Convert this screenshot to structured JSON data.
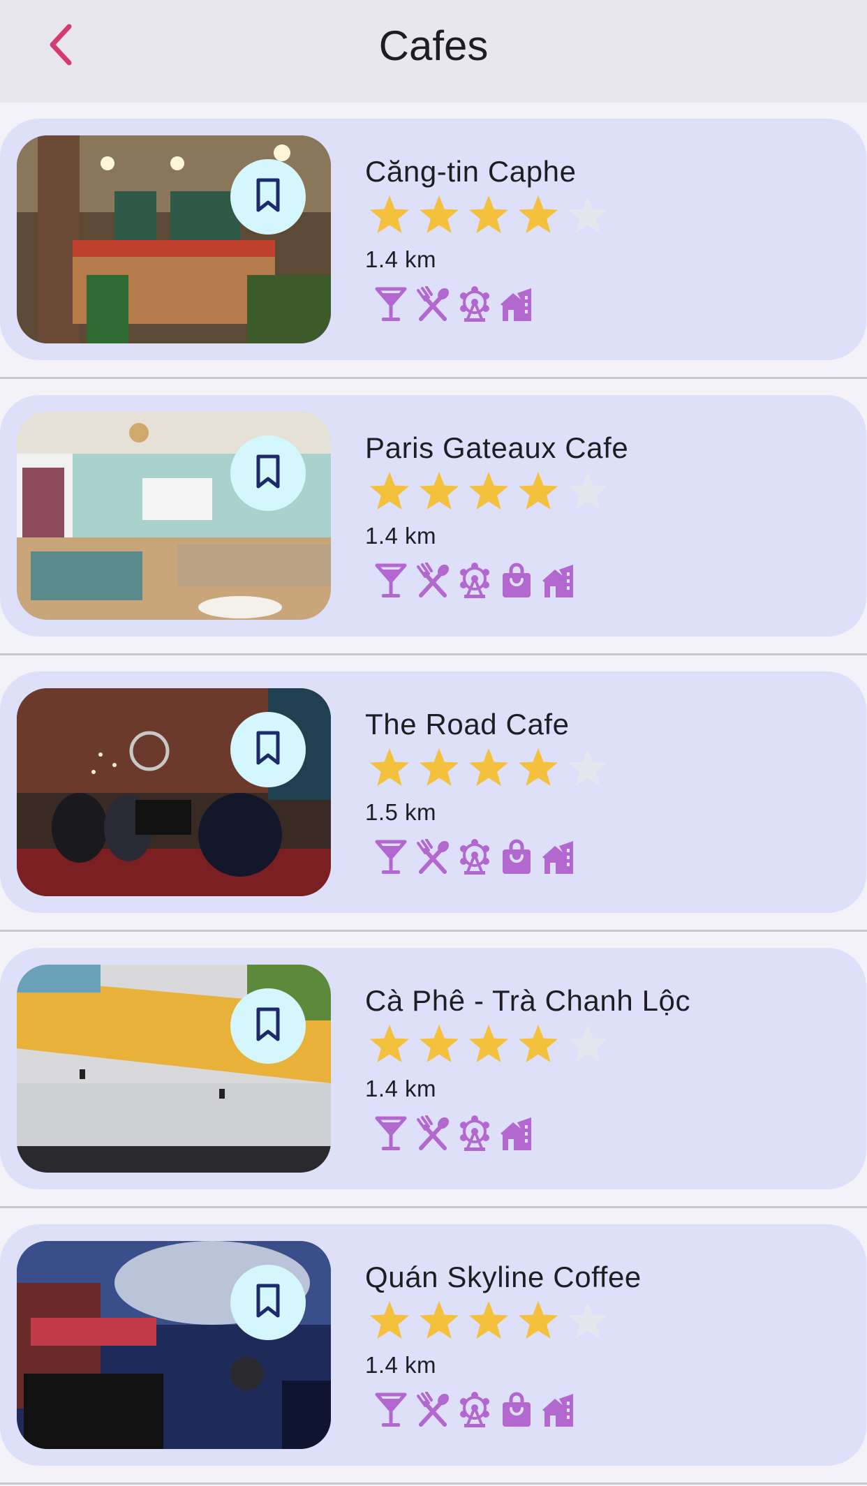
{
  "header": {
    "title": "Cafes",
    "back_icon": "chevron-left-icon"
  },
  "colors": {
    "accent": "#d63a6e",
    "card_bg": "#dedff8",
    "star_filled": "#f4c13c",
    "star_empty": "#e6e6ee",
    "amenity_icon": "#b268cf",
    "bookmark_bg": "#d4f6fd",
    "bookmark_icon": "#1c2a6b"
  },
  "cafes": [
    {
      "name": "Căng-tin Caphe",
      "rating": 4,
      "max_rating": 5,
      "distance": "1.4 km",
      "amenities": [
        "cocktail-icon",
        "utensils-icon",
        "ferris-wheel-icon",
        "house-icon"
      ]
    },
    {
      "name": "Paris Gateaux Cafe",
      "rating": 4,
      "max_rating": 5,
      "distance": "1.4 km",
      "amenities": [
        "cocktail-icon",
        "utensils-icon",
        "ferris-wheel-icon",
        "shopping-bag-icon",
        "house-icon"
      ]
    },
    {
      "name": "The Road Cafe",
      "rating": 4,
      "max_rating": 5,
      "distance": "1.5 km",
      "amenities": [
        "cocktail-icon",
        "utensils-icon",
        "ferris-wheel-icon",
        "shopping-bag-icon",
        "house-icon"
      ]
    },
    {
      "name": "Cà Phê - Trà Chanh Lộc",
      "rating": 4,
      "max_rating": 5,
      "distance": "1.4 km",
      "amenities": [
        "cocktail-icon",
        "utensils-icon",
        "ferris-wheel-icon",
        "house-icon"
      ]
    },
    {
      "name": "Quán Skyline Coffee",
      "rating": 4,
      "max_rating": 5,
      "distance": "1.4 km",
      "amenities": [
        "cocktail-icon",
        "utensils-icon",
        "ferris-wheel-icon",
        "shopping-bag-icon",
        "house-icon"
      ]
    }
  ]
}
